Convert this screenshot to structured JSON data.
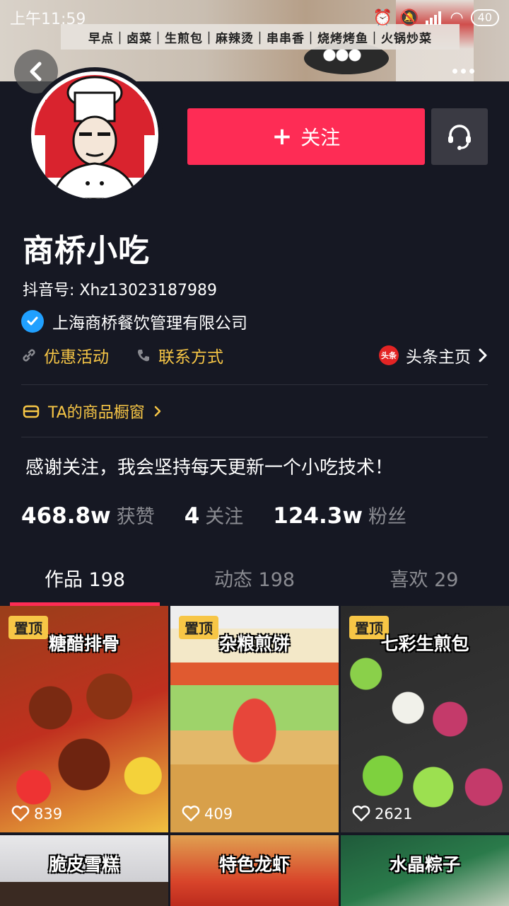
{
  "status_bar": {
    "time": "上午11:59",
    "battery": "40"
  },
  "cover": {
    "banner": "早点｜卤菜｜生煎包｜麻辣烫｜串串香｜烧烤烤鱼｜火锅炒菜"
  },
  "profile": {
    "follow_label": "关注",
    "name": "商桥小吃",
    "douyin_id": "抖音号: Xhz13023187989",
    "verified_name": "上海商桥餐饮管理有限公司",
    "links": {
      "promo": "优惠活动",
      "contact": "联系方式",
      "toutiao": "头条主页",
      "toutiao_logo_text": "头条"
    },
    "shop_window": "TA的商品橱窗",
    "bio": "感谢关注，我会坚持每天更新一个小吃技术！",
    "stats": [
      {
        "num": "468.8w",
        "label": "获赞"
      },
      {
        "num": "4",
        "label": "关注"
      },
      {
        "num": "124.3w",
        "label": "粉丝"
      }
    ]
  },
  "tabs": [
    {
      "label": "作品 198",
      "active": true
    },
    {
      "label": "动态 198",
      "active": false
    },
    {
      "label": "喜欢 29",
      "active": false
    }
  ],
  "videos": [
    {
      "pin": "置顶",
      "title": "糖醋排骨",
      "likes": "839"
    },
    {
      "pin": "置顶",
      "title": "杂粮煎饼",
      "likes": "409"
    },
    {
      "pin": "置顶",
      "title": "七彩生煎包",
      "likes": "2621"
    },
    {
      "title": "脆皮雪糕"
    },
    {
      "title": "特色龙虾"
    },
    {
      "title": "水晶粽子"
    }
  ],
  "colors": {
    "background": "#161823",
    "accent": "#fe2c55",
    "highlight": "#f7c646"
  }
}
